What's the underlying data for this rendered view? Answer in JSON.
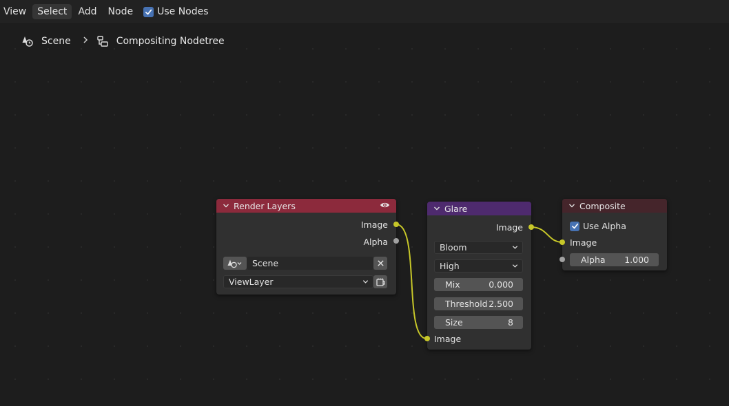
{
  "header": {
    "menu": [
      "View",
      "Select",
      "Add",
      "Node"
    ],
    "use_nodes_label": "Use Nodes",
    "use_nodes_checked": true
  },
  "breadcrumb": {
    "scene": "Scene",
    "tree": "Compositing Nodetree"
  },
  "nodes": {
    "render_layers": {
      "title": "Render Layers",
      "header_color": "#8c2a3c",
      "outputs": [
        "Image",
        "Alpha"
      ],
      "scene_value": "Scene",
      "layer_value": "ViewLayer"
    },
    "glare": {
      "title": "Glare",
      "header_color": "#4e2a6e",
      "output": "Image",
      "type_value": "Bloom",
      "quality_value": "High",
      "mix_label": "Mix",
      "mix_value": "0.000",
      "threshold_label": "Threshold",
      "threshold_value": "2.500",
      "size_label": "Size",
      "size_value": "8",
      "input": "Image"
    },
    "composite": {
      "title": "Composite",
      "header_color": "#45252b",
      "use_alpha_label": "Use Alpha",
      "use_alpha_checked": true,
      "input": "Image",
      "alpha_label": "Alpha",
      "alpha_value": "1.000"
    }
  },
  "colors": {
    "link": "#c7c729",
    "checkbox": "#4772b3"
  }
}
